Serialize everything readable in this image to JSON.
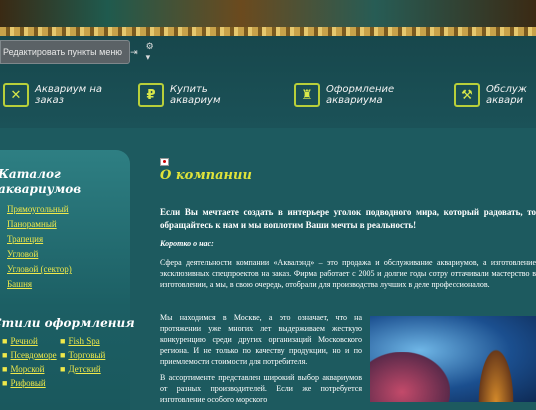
{
  "editbar": {
    "label": "Редактировать пункты меню",
    "icon_a": "arrows-icon",
    "icon_b": "gear-icon"
  },
  "nav": [
    {
      "icon": "tools-icon",
      "line1": "Аквариум на",
      "line2": "заказ"
    },
    {
      "icon": "ruble-icon",
      "line1": "Купить",
      "line2": "аквариум"
    },
    {
      "icon": "castle-icon",
      "line1": "Оформление",
      "line2": "аквариума"
    },
    {
      "icon": "service-icon",
      "line1": "Обслуж",
      "line2": "аквари"
    }
  ],
  "catalog": {
    "title_1": "Каталог",
    "title_2": "аквариумов",
    "items": [
      "Прямоугольный",
      "Панорамный",
      "Трапеция",
      "Угловой",
      "Угловой (сектор)",
      "Башня"
    ]
  },
  "styles": {
    "title": "Стили оформления",
    "col1": [
      "Речной",
      "Псевдоморе",
      "Морской",
      "Рифовый"
    ],
    "col2": [
      "Fish Spa",
      "Торговый",
      "Детский"
    ]
  },
  "content": {
    "heading": "О компании",
    "lead": "Если Вы мечтаете создать в интерьере уголок подводного мира, который радовать, то обращайтесь к нам и мы воплотим Ваши мечты в реальность!",
    "subheading": "Коротко о нас:",
    "p1": "Сфера деятельности компании «Аквалэнд» – это продажа и обслуживание аквариумов, а изготовление эксклюзивных спецпроектов на заказ. Фирма работает с 2005 и долгие годы сотру оттачивали мастерство в изготовлении, а мы, в свою очередь, отобрали для производства лучших в деле профессионалов.",
    "p2": "Мы находимся в Москве, а это означает, что на протяжении уже многих лет выдерживаем жесткую конкуренцию среди других организаций Московского региона. И не только по качеству продукции, но и по приемлемости стоимости для потребителя.",
    "p3": "В ассортименте представлен широкий выбор аквариумов от разных производителей. Если же потребуется изготовление особого морского"
  }
}
